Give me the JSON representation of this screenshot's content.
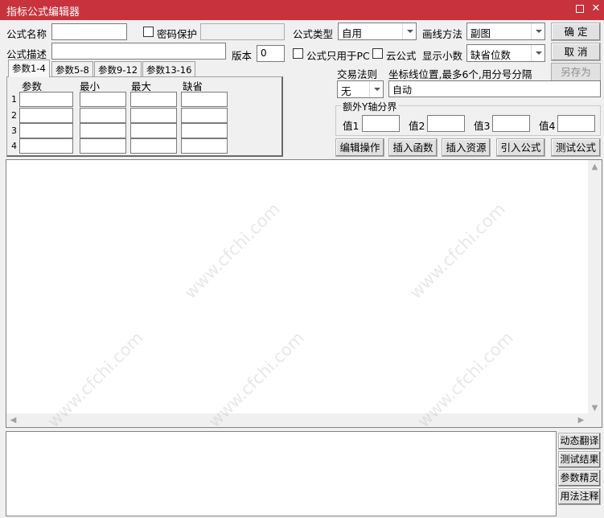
{
  "window": {
    "title": "指标公式编辑器",
    "maximize_icon": "maximize-icon",
    "close_icon": "close-icon",
    "close_glyph": "✕"
  },
  "form": {
    "name_label": "公式名称",
    "name_value": "",
    "password_label": "密码保护",
    "password_value": "",
    "desc_label": "公式描述",
    "desc_value": "",
    "version_label": "版本",
    "version_value": "0",
    "type_label": "公式类型",
    "type_value": "自用",
    "draw_label": "画线方法",
    "draw_value": "副图",
    "pc_only_label": "公式只用于PC",
    "cloud_label": "云公式",
    "decimals_label": "显示小数",
    "decimals_value": "缺省位数",
    "trade_rule_label": "交易法则",
    "trade_rule_value": "无",
    "coord_label": "坐标线位置,最多6个,用分号分隔",
    "coord_value": "自动",
    "extra_y_label": "额外Y轴分界",
    "val1_label": "值1",
    "val2_label": "值2",
    "val3_label": "值3",
    "val4_label": "值4"
  },
  "buttons": {
    "ok": "确  定",
    "cancel": "取  消",
    "save_as": "另存为",
    "edit_ops": "编辑操作",
    "insert_func": "插入函数",
    "insert_res": "插入资源",
    "import_formula": "引入公式",
    "test_formula": "测试公式"
  },
  "tabs": [
    "参数1-4",
    "参数5-8",
    "参数9-12",
    "参数13-16"
  ],
  "params": {
    "headers": [
      "参数",
      "最小",
      "最大",
      "缺省"
    ],
    "rows": [
      "1",
      "2",
      "3",
      "4"
    ]
  },
  "side_buttons": [
    "动态翻译",
    "测试结果",
    "参数精灵",
    "用法注释"
  ],
  "watermark": "www.cfchi.com",
  "colors": {
    "titlebar": "#c8323c",
    "background": "#f0f0f0"
  }
}
